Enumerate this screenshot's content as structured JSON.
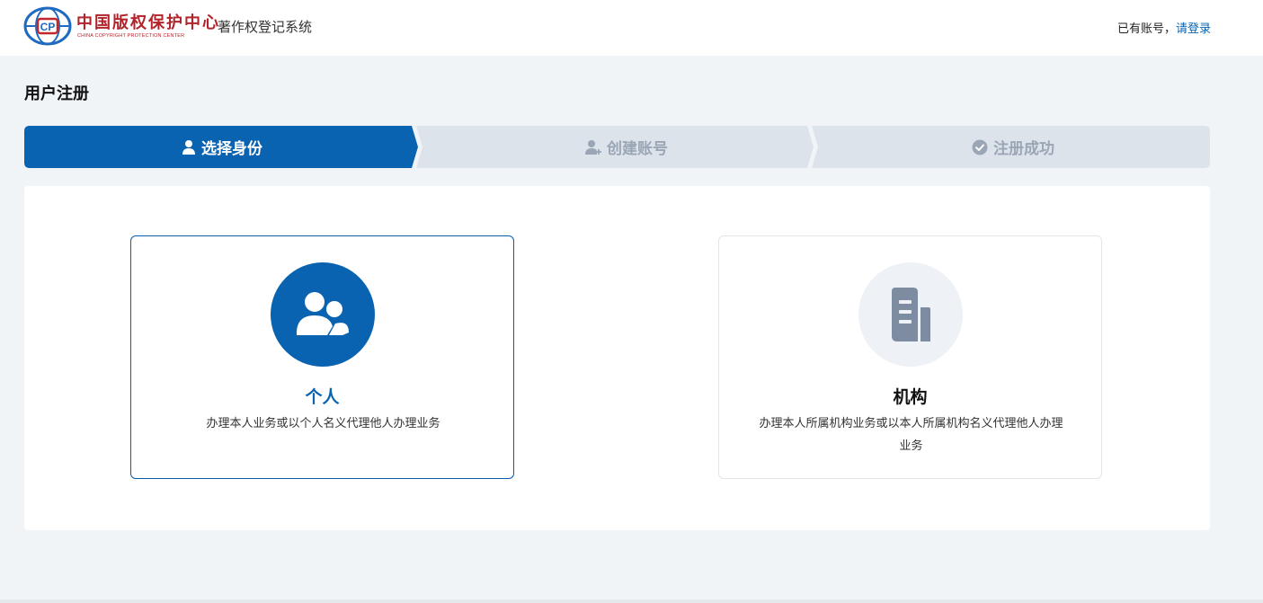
{
  "header": {
    "logo_cn": "中国版权保护中心",
    "logo_en": "CHINA COPYRIGHT PROTECTION CENTER",
    "system_name": "著作权登记系统",
    "login_prompt": "已有账号，",
    "login_link": "请登录"
  },
  "page_title": "用户注册",
  "steps": [
    {
      "label": "选择身份",
      "icon": "user-icon",
      "state": "active"
    },
    {
      "label": "创建账号",
      "icon": "user-add-icon",
      "state": "inactive"
    },
    {
      "label": "注册成功",
      "icon": "check-circle-icon",
      "state": "inactive"
    }
  ],
  "cards": {
    "personal": {
      "icon": "users-icon",
      "title": "个人",
      "desc": "办理本人业务或以个人名义代理他人办理业务",
      "selected": true
    },
    "organization": {
      "icon": "document-icon",
      "title": "机构",
      "desc": "办理本人所属机构业务或以本人所属机构名义代理他人办理业务",
      "selected": false
    }
  },
  "colors": {
    "primary": "#0a63b0",
    "step_inactive_bg": "#dde3ea",
    "step_inactive_text": "#9aa6b6",
    "page_bg": "#f1f4f7",
    "logo_red": "#b2232b"
  }
}
